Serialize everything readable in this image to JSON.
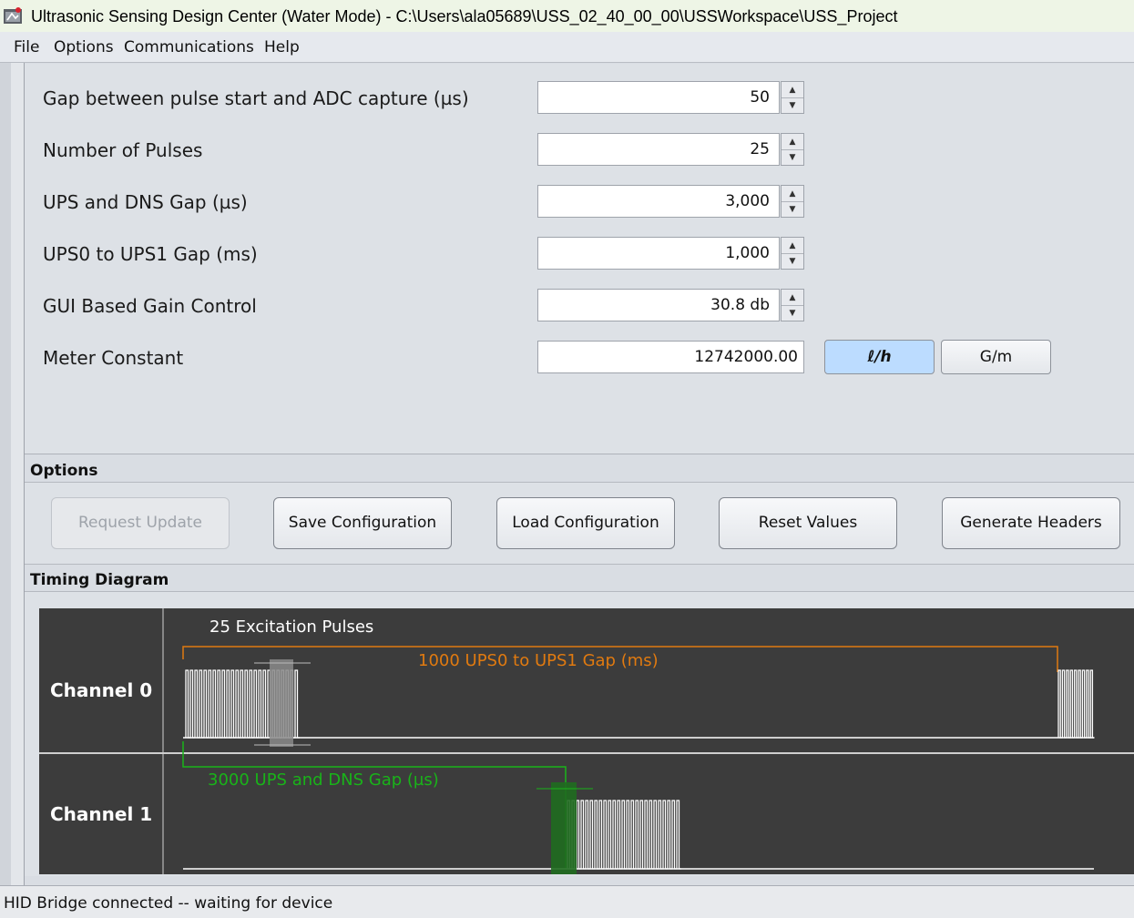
{
  "window": {
    "title": "Ultrasonic Sensing Design Center (Water Mode) - C:\\Users\\ala05689\\USS_02_40_00_00\\USSWorkspace\\USS_Project"
  },
  "menu": {
    "file": "File",
    "options": "Options",
    "communications": "Communications",
    "help": "Help"
  },
  "config": {
    "gap_adc": {
      "label": "Gap between pulse start and ADC capture (µs)",
      "value": "50"
    },
    "num_pulses": {
      "label": "Number of Pulses",
      "value": "25"
    },
    "ups_dns_gap": {
      "label": "UPS and DNS Gap (µs)",
      "value": "3,000"
    },
    "ups0_ups1_gap": {
      "label": "UPS0 to UPS1 Gap (ms)",
      "value": "1,000"
    },
    "gain": {
      "label": "GUI Based Gain Control",
      "value": "30.8 db"
    },
    "meter": {
      "label": "Meter Constant",
      "value": "12742000.00",
      "unit_lh": "ℓ/h",
      "unit_gm": "G/m"
    }
  },
  "options": {
    "title": "Options",
    "request_update": "Request Update",
    "save": "Save Configuration",
    "load": "Load Configuration",
    "reset": "Reset Values",
    "generate": "Generate Headers"
  },
  "timing": {
    "title": "Timing Diagram",
    "channel0": "Channel 0",
    "channel1": "Channel 1",
    "pulses_label": "25 Excitation Pulses",
    "ups_gap_label": "1000 UPS0 to UPS1 Gap (ms)",
    "dns_gap_label": "3000 UPS and DNS Gap (µs)",
    "colors": {
      "pulse": "#ffffff",
      "ups_gap": "#e07a10",
      "dns_gap": "#19b319",
      "background": "#3c3c3c"
    }
  },
  "status": {
    "text": "HID Bridge connected -- waiting for device"
  },
  "colors": {
    "unit_selected": "#bcdcff",
    "panel": "#dde1e6"
  }
}
